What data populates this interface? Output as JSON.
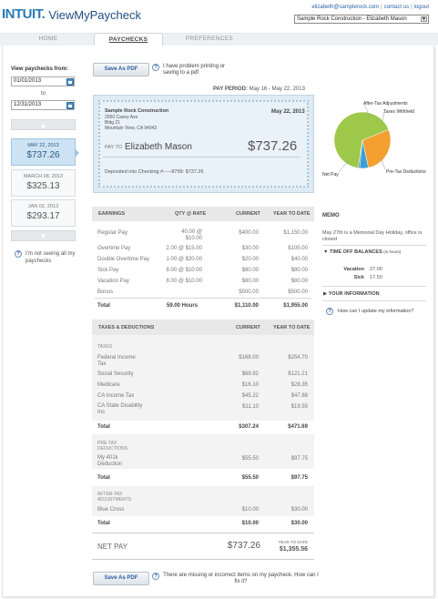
{
  "brand": {
    "logo": "INTUIT.",
    "product": "ViewMyPaycheck"
  },
  "toplinks": {
    "email": "elizabeth@samplerock.com",
    "contact": "contact us",
    "logout": "logout"
  },
  "company_select": {
    "value": "Sample Rock Construction - Elizabeth Mason"
  },
  "tabs": [
    "HOME",
    "PAYCHECKS",
    "PREFERENCES"
  ],
  "sidebar": {
    "view_from_label": "View paychecks from:",
    "from_date": "01/01/2013",
    "to_label": "to",
    "to_date": "12/31/2013",
    "paychecks": [
      {
        "date": "MAY 22, 2013",
        "amount": "$737.26"
      },
      {
        "date": "MARCH 08, 2013",
        "amount": "$325.13"
      },
      {
        "date": "JAN 02, 2013",
        "amount": "$293.17"
      }
    ],
    "not_seeing": "I'm not seeing all my paychecks"
  },
  "save_pdf": "Save As PDF",
  "print_help": "I have problem printing or saving to a pdf",
  "pay_period": {
    "label": "PAY PERIOD:",
    "value": "May 16 - May 22, 2013"
  },
  "check": {
    "company": "Sample Rock Construction",
    "addr1": "2050 Casey Ave",
    "addr2": "Bldg 21",
    "addr3": "Mountain View, CA 94043",
    "date": "May 22, 2013",
    "payto_label": "PAY TO",
    "payee": "Elizabeth Mason",
    "amount": "$737.26",
    "deposit": "Deposited into Checking #-----8799: $737.26"
  },
  "earnings": {
    "headers": [
      "EARNINGS",
      "QTY @ RATE",
      "CURRENT",
      "YEAR TO DATE"
    ],
    "rows": [
      {
        "name": "Regular Pay",
        "qty": "40.00 @",
        "rate": "$10.00",
        "current": "$400.00",
        "ytd": "$1,150.00"
      },
      {
        "name": "Overtime Pay",
        "qty": "2.00 @ $15.00",
        "current": "$30.00",
        "ytd": "$105.00"
      },
      {
        "name": "Double Overtime Pay",
        "qty": "1.00 @ $20.00",
        "current": "$20.00",
        "ytd": "$40.00"
      },
      {
        "name": "Sick Pay",
        "qty": "8.00 @ $10.00",
        "current": "$80.00",
        "ytd": "$80.00"
      },
      {
        "name": "Vacation Pay",
        "qty": "8.00 @ $10.00",
        "current": "$80.00",
        "ytd": "$80.00"
      },
      {
        "name": "Bonus",
        "qty": "",
        "current": "$500.00",
        "ytd": "$500.00"
      }
    ],
    "total": {
      "label": "Total",
      "qty": "59.00 Hours",
      "current": "$1,110.00",
      "ytd": "$1,955.00"
    }
  },
  "taxes": {
    "headers": [
      "TAXES & DEDUCTIONS",
      "CURRENT",
      "YEAR TO DATE"
    ],
    "taxes_label": "TAXES",
    "tax_rows": [
      {
        "name1": "Federal Income",
        "name2": "Tax",
        "current": "$168.00",
        "ytd": "$254.70"
      },
      {
        "name1": "Social Security",
        "name2": "",
        "current": "$68.82",
        "ytd": "$121.21"
      },
      {
        "name1": "Medicare",
        "name2": "",
        "current": "$16.10",
        "ytd": "$28.35"
      },
      {
        "name1": "CA Income Tax",
        "name2": "",
        "current": "$45.22",
        "ytd": "$47.88"
      },
      {
        "name1": "CA State Disability",
        "name2": "Ins",
        "current": "$11.10",
        "ytd": "$19.55"
      }
    ],
    "tax_total": {
      "label": "Total",
      "current": "$307.24",
      "ytd": "$471.69"
    },
    "pretax_label1": "PRE-TAX",
    "pretax_label2": "DEDUCTIONS",
    "pretax_row": {
      "name1": "My 401k",
      "name2": "Deduction",
      "current": "$55.50",
      "ytd": "$97.75"
    },
    "pretax_total": {
      "label": "Total",
      "current": "$55.50",
      "ytd": "$97.75"
    },
    "aftertax_label1": "AFTER-TAX",
    "aftertax_label2": "ADJUSTMENTS",
    "aftertax_row": {
      "name": "Blue Cross",
      "current": "$10.00",
      "ytd": "$30.00"
    },
    "aftertax_total": {
      "label": "Total",
      "current": "$10.00",
      "ytd": "$30.00"
    }
  },
  "netpay": {
    "label": "NET PAY",
    "current": "$737.26",
    "ytd_label": "YEAR TO DATE",
    "ytd": "$1,355.56"
  },
  "bottom_help": "There are missing or incorrect items on my paycheck. How can I fix it?",
  "pie": {
    "labels": {
      "aftertax": "After-Tax Adjustments",
      "taxes": "Taxes Withheld",
      "pretax": "Pre-Tax Deductions",
      "net": "Net Pay"
    },
    "slices": [
      {
        "name": "Net Pay",
        "value": 737.26,
        "color": "#9dc84a"
      },
      {
        "name": "Taxes Withheld",
        "value": 307.24,
        "color": "#f4a030"
      },
      {
        "name": "Pre-Tax Deductions",
        "value": 55.5,
        "color": "#3d9fd6"
      },
      {
        "name": "After-Tax Adjustments",
        "value": 10.0,
        "color": "#6b8fb3"
      }
    ]
  },
  "memo": {
    "title": "MEMO",
    "text": "May 27th is a Memorial Day Holiday, office is closed"
  },
  "timeoff": {
    "title": "TIME OFF BALANCES",
    "unit": "(in hours)",
    "vacation_label": "Vacation",
    "vacation_value": "27.00",
    "sick_label": "Sick",
    "sick_value": "17.50"
  },
  "yourinfo": {
    "title": "YOUR INFORMATION",
    "question": "How can I update my information?"
  }
}
